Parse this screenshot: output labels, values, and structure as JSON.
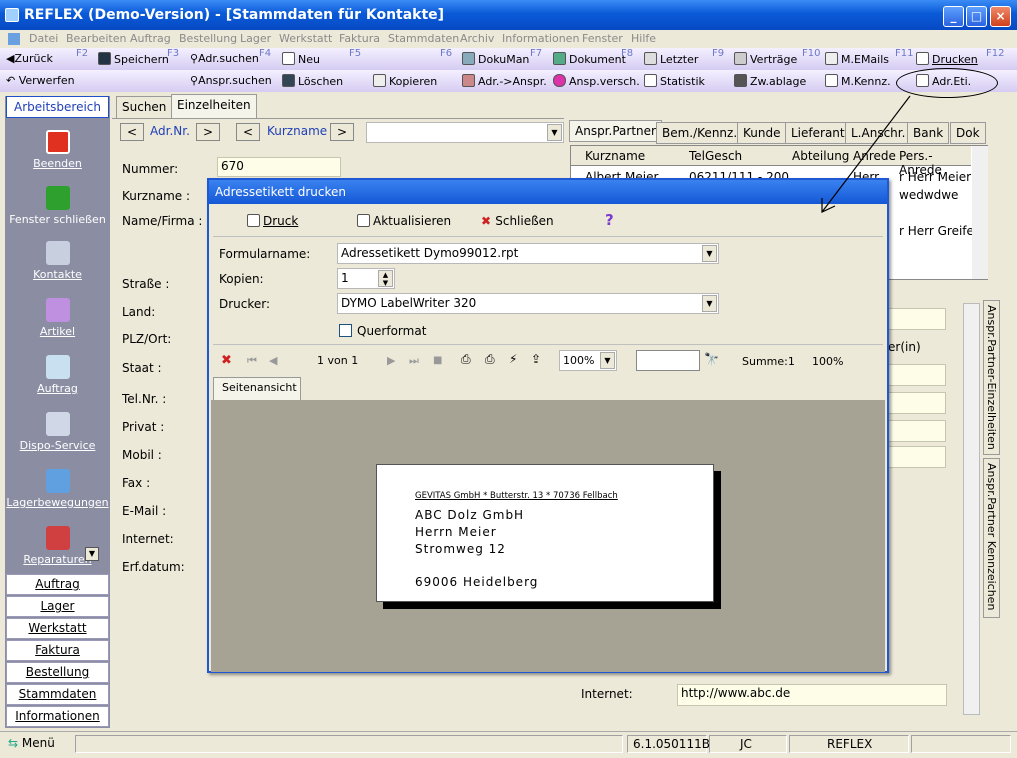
{
  "window": {
    "title": "REFLEX (Demo-Version) - [Stammdaten für Kontakte]",
    "min": "_",
    "max": "□",
    "close": "×"
  },
  "menu": [
    "Datei",
    "Bearbeiten",
    "Auftrag",
    "Bestellung",
    "Lager",
    "Werkstatt",
    "Faktura",
    "Stammdaten",
    "Archiv",
    "Informationen",
    "Fenster",
    "Hilfe"
  ],
  "toolbar1": {
    "zurueck": "Zurück",
    "speichern": "Speichern",
    "adrsuchen": "Adr.suchen",
    "neu": "Neu",
    "dokuman": "DokuMan",
    "dokument": "Dokument",
    "letzter": "Letzter",
    "vertraege": "Verträge",
    "memails": "M.EMails",
    "drucken": "Drucken",
    "f2": "F2",
    "f3": "F3",
    "f4": "F4",
    "f5": "F5",
    "f6": "F6",
    "f7": "F7",
    "f8": "F8",
    "f9": "F9",
    "f10": "F10",
    "f11": "F11",
    "f12": "F12"
  },
  "toolbar2": {
    "verwerfen": "Verwerfen",
    "anspsuchen": "Anspr.suchen",
    "loeschen": "Löschen",
    "kopieren": "Kopieren",
    "adranspr": "Adr.->Anspr.",
    "anspversch": "Ansp.versch.",
    "statistik": "Statistik",
    "zwablage": "Zw.ablage",
    "mkennz": "M.Kennz.",
    "adreti": "Adr.Eti."
  },
  "left": {
    "header": "Arbeitsbereich",
    "beenden": "Beenden",
    "fenster": "Fenster schließen",
    "kontakte": "Kontakte",
    "artikel": "Artikel",
    "auftrag": "Auftrag",
    "dispo": "Dispo-Service",
    "lagerbew": "Lagerbewegungen",
    "reparaturen": "Reparaturen",
    "cats": [
      "Auftrag",
      "Lager",
      "Werkstatt",
      "Faktura",
      "Bestellung",
      "Stammdaten",
      "Informationen"
    ]
  },
  "maintabs": {
    "suchen": "Suchen",
    "einzel": "Einzelheiten"
  },
  "nav": {
    "adrnr": "Adr.Nr.",
    "kurzname": "Kurzname"
  },
  "form": {
    "nummer_label": "Nummer:",
    "nummer": "670",
    "kurzname": "Kurzname :",
    "name": "Name/Firma :",
    "strasse": "Straße :",
    "land": "Land:",
    "plz": "PLZ/Ort:",
    "staat": "Staat :",
    "tel": "Tel.Nr. :",
    "privat": "Privat :",
    "mobil": "Mobil :",
    "fax": "Fax :",
    "email": "E-Mail :",
    "internet": "Internet:",
    "erfdatum": "Erf.datum:"
  },
  "right": {
    "tabs": [
      "Anspr.Partner",
      "Bem./Kennz.",
      "Kunde",
      "Lieferant",
      "L.Anschr.",
      "Bank",
      "Dok"
    ],
    "cols": [
      "Kurzname",
      "TelGesch",
      "Abteilung",
      "Anrede",
      "Pers.-Anrede"
    ],
    "row1": [
      "Albert Meier",
      "06211/111 - 200",
      "",
      "Herr",
      "r Herr Meier"
    ],
    "row2": "wedwdwe",
    "row3": "r Herr Greifer",
    "partner_in": "er(in)",
    "internet_label": "Internet:",
    "internet_value": "http://www.abc.de",
    "vtab1": "Anspr.Partner-Einzelheiten",
    "vtab2": "Anspr.Partner Kennzeichen"
  },
  "dialog": {
    "title": "Adressetikett drucken",
    "druck": "Druck",
    "aktualisieren": "Aktualisieren",
    "schliessen": "Schließen",
    "help": "?",
    "formular_label": "Formularname:",
    "formular": "Adressetikett Dymo99012.rpt",
    "kopien_label": "Kopien:",
    "kopien": "1",
    "drucker_label": "Drucker:",
    "drucker": "DYMO LabelWriter 320",
    "querformat": "Querformat",
    "page": "1 von 1",
    "zoom": "100%",
    "summe": "Summe:1",
    "pct": "100%",
    "seitenansicht": "Seitenansicht",
    "label": {
      "sender": "GEVITAS GmbH * Butterstr. 13 * 70736 Fellbach",
      "l1": "ABC Dolz GmbH",
      "l2": "Herrn Meier",
      "l3": "Stromweg 12",
      "l4": "69006  Heidelberg"
    }
  },
  "status": {
    "menu": "Menü",
    "version": "6.1.050111B",
    "user": "JC",
    "app": "REFLEX"
  }
}
